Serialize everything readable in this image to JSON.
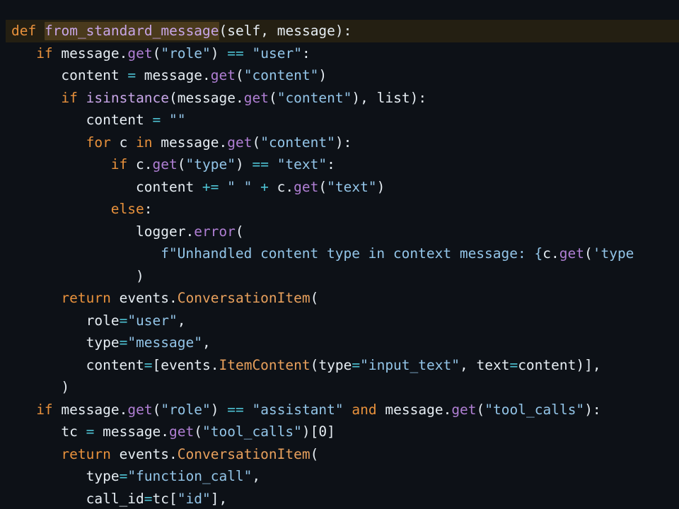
{
  "editor": {
    "language": "python",
    "background_color": "#0d1117",
    "active_line_color": "#241f12",
    "word_highlight_color": "#4a3a1c",
    "theme_colors": {
      "keyword": "#e8913c",
      "function_name": "#c8a6e8",
      "method": "#b07fd4",
      "builtin": "#c8a6e8",
      "class_name": "#e8a05c",
      "string": "#93c5e8",
      "operator": "#4ec3d4",
      "text": "#e6edf3"
    },
    "active_line_number": 1,
    "highlighted_word": "from_standard_message",
    "lines": [
      {
        "indent": 1,
        "active": true,
        "tokens": [
          {
            "t": "def",
            "c": "kw"
          },
          {
            "t": " ",
            "c": "plain"
          },
          {
            "t": "from_standard_message",
            "c": "fnname",
            "hl": true
          },
          {
            "t": "(",
            "c": "punc"
          },
          {
            "t": "self",
            "c": "plain"
          },
          {
            "t": ", ",
            "c": "punc"
          },
          {
            "t": "message",
            "c": "plain"
          },
          {
            "t": "):",
            "c": "punc"
          }
        ]
      },
      {
        "indent": 2,
        "active": false,
        "tokens": [
          {
            "t": "if",
            "c": "kw"
          },
          {
            "t": " message",
            "c": "plain"
          },
          {
            "t": ".",
            "c": "punc"
          },
          {
            "t": "get",
            "c": "method"
          },
          {
            "t": "(",
            "c": "punc"
          },
          {
            "t": "\"role\"",
            "c": "str"
          },
          {
            "t": ")",
            "c": "punc"
          },
          {
            "t": " ",
            "c": "plain"
          },
          {
            "t": "==",
            "c": "op"
          },
          {
            "t": " ",
            "c": "plain"
          },
          {
            "t": "\"user\"",
            "c": "str"
          },
          {
            "t": ":",
            "c": "punc"
          }
        ]
      },
      {
        "indent": 3,
        "active": false,
        "tokens": [
          {
            "t": "content ",
            "c": "plain"
          },
          {
            "t": "=",
            "c": "op"
          },
          {
            "t": " message",
            "c": "plain"
          },
          {
            "t": ".",
            "c": "punc"
          },
          {
            "t": "get",
            "c": "method"
          },
          {
            "t": "(",
            "c": "punc"
          },
          {
            "t": "\"content\"",
            "c": "str"
          },
          {
            "t": ")",
            "c": "punc"
          }
        ]
      },
      {
        "indent": 3,
        "active": false,
        "tokens": [
          {
            "t": "if",
            "c": "kw"
          },
          {
            "t": " ",
            "c": "plain"
          },
          {
            "t": "isinstance",
            "c": "builtin"
          },
          {
            "t": "(",
            "c": "punc"
          },
          {
            "t": "message",
            "c": "plain"
          },
          {
            "t": ".",
            "c": "punc"
          },
          {
            "t": "get",
            "c": "method"
          },
          {
            "t": "(",
            "c": "punc"
          },
          {
            "t": "\"content\"",
            "c": "str"
          },
          {
            "t": "), ",
            "c": "punc"
          },
          {
            "t": "list",
            "c": "plain"
          },
          {
            "t": "):",
            "c": "punc"
          }
        ]
      },
      {
        "indent": 4,
        "active": false,
        "tokens": [
          {
            "t": "content ",
            "c": "plain"
          },
          {
            "t": "=",
            "c": "op"
          },
          {
            "t": " ",
            "c": "plain"
          },
          {
            "t": "\"\"",
            "c": "str"
          }
        ]
      },
      {
        "indent": 4,
        "active": false,
        "tokens": [
          {
            "t": "for",
            "c": "kw"
          },
          {
            "t": " c ",
            "c": "plain"
          },
          {
            "t": "in",
            "c": "kw"
          },
          {
            "t": " message",
            "c": "plain"
          },
          {
            "t": ".",
            "c": "punc"
          },
          {
            "t": "get",
            "c": "method"
          },
          {
            "t": "(",
            "c": "punc"
          },
          {
            "t": "\"content\"",
            "c": "str"
          },
          {
            "t": "):",
            "c": "punc"
          }
        ]
      },
      {
        "indent": 5,
        "active": false,
        "tokens": [
          {
            "t": "if",
            "c": "kw"
          },
          {
            "t": " c",
            "c": "plain"
          },
          {
            "t": ".",
            "c": "punc"
          },
          {
            "t": "get",
            "c": "method"
          },
          {
            "t": "(",
            "c": "punc"
          },
          {
            "t": "\"type\"",
            "c": "str"
          },
          {
            "t": ")",
            "c": "punc"
          },
          {
            "t": " ",
            "c": "plain"
          },
          {
            "t": "==",
            "c": "op"
          },
          {
            "t": " ",
            "c": "plain"
          },
          {
            "t": "\"text\"",
            "c": "str"
          },
          {
            "t": ":",
            "c": "punc"
          }
        ]
      },
      {
        "indent": 6,
        "active": false,
        "tokens": [
          {
            "t": "content ",
            "c": "plain"
          },
          {
            "t": "+=",
            "c": "op"
          },
          {
            "t": " ",
            "c": "plain"
          },
          {
            "t": "\" \"",
            "c": "str"
          },
          {
            "t": " ",
            "c": "plain"
          },
          {
            "t": "+",
            "c": "op"
          },
          {
            "t": " c",
            "c": "plain"
          },
          {
            "t": ".",
            "c": "punc"
          },
          {
            "t": "get",
            "c": "method"
          },
          {
            "t": "(",
            "c": "punc"
          },
          {
            "t": "\"text\"",
            "c": "str"
          },
          {
            "t": ")",
            "c": "punc"
          }
        ]
      },
      {
        "indent": 5,
        "active": false,
        "tokens": [
          {
            "t": "else",
            "c": "kw"
          },
          {
            "t": ":",
            "c": "punc"
          }
        ]
      },
      {
        "indent": 6,
        "active": false,
        "tokens": [
          {
            "t": "logger",
            "c": "plain"
          },
          {
            "t": ".",
            "c": "punc"
          },
          {
            "t": "error",
            "c": "method"
          },
          {
            "t": "(",
            "c": "punc"
          }
        ]
      },
      {
        "indent": 7,
        "active": false,
        "tokens": [
          {
            "t": "f\"Unhandled content type in context message: {",
            "c": "str"
          },
          {
            "t": "c",
            "c": "plain"
          },
          {
            "t": ".",
            "c": "punc"
          },
          {
            "t": "get",
            "c": "method"
          },
          {
            "t": "(",
            "c": "punc"
          },
          {
            "t": "'type",
            "c": "str"
          }
        ]
      },
      {
        "indent": 6,
        "active": false,
        "tokens": [
          {
            "t": ")",
            "c": "punc"
          }
        ]
      },
      {
        "indent": 3,
        "active": false,
        "tokens": [
          {
            "t": "return",
            "c": "kw"
          },
          {
            "t": " events",
            "c": "plain"
          },
          {
            "t": ".",
            "c": "punc"
          },
          {
            "t": "ConversationItem",
            "c": "class"
          },
          {
            "t": "(",
            "c": "punc"
          }
        ]
      },
      {
        "indent": 4,
        "active": false,
        "tokens": [
          {
            "t": "role",
            "c": "plain"
          },
          {
            "t": "=",
            "c": "op"
          },
          {
            "t": "\"user\"",
            "c": "str"
          },
          {
            "t": ",",
            "c": "punc"
          }
        ]
      },
      {
        "indent": 4,
        "active": false,
        "tokens": [
          {
            "t": "type",
            "c": "plain"
          },
          {
            "t": "=",
            "c": "op"
          },
          {
            "t": "\"message\"",
            "c": "str"
          },
          {
            "t": ",",
            "c": "punc"
          }
        ]
      },
      {
        "indent": 4,
        "active": false,
        "tokens": [
          {
            "t": "content",
            "c": "plain"
          },
          {
            "t": "=",
            "c": "op"
          },
          {
            "t": "[",
            "c": "punc"
          },
          {
            "t": "events",
            "c": "plain"
          },
          {
            "t": ".",
            "c": "punc"
          },
          {
            "t": "ItemContent",
            "c": "class"
          },
          {
            "t": "(",
            "c": "punc"
          },
          {
            "t": "type",
            "c": "plain"
          },
          {
            "t": "=",
            "c": "op"
          },
          {
            "t": "\"input_text\"",
            "c": "str"
          },
          {
            "t": ", ",
            "c": "punc"
          },
          {
            "t": "text",
            "c": "plain"
          },
          {
            "t": "=",
            "c": "op"
          },
          {
            "t": "content",
            "c": "plain"
          },
          {
            "t": ")],",
            "c": "punc"
          }
        ]
      },
      {
        "indent": 3,
        "active": false,
        "tokens": [
          {
            "t": ")",
            "c": "punc"
          }
        ]
      },
      {
        "indent": 2,
        "active": false,
        "tokens": [
          {
            "t": "if",
            "c": "kw"
          },
          {
            "t": " message",
            "c": "plain"
          },
          {
            "t": ".",
            "c": "punc"
          },
          {
            "t": "get",
            "c": "method"
          },
          {
            "t": "(",
            "c": "punc"
          },
          {
            "t": "\"role\"",
            "c": "str"
          },
          {
            "t": ")",
            "c": "punc"
          },
          {
            "t": " ",
            "c": "plain"
          },
          {
            "t": "==",
            "c": "op"
          },
          {
            "t": " ",
            "c": "plain"
          },
          {
            "t": "\"assistant\"",
            "c": "str"
          },
          {
            "t": " ",
            "c": "plain"
          },
          {
            "t": "and",
            "c": "kw"
          },
          {
            "t": " message",
            "c": "plain"
          },
          {
            "t": ".",
            "c": "punc"
          },
          {
            "t": "get",
            "c": "method"
          },
          {
            "t": "(",
            "c": "punc"
          },
          {
            "t": "\"tool_calls\"",
            "c": "str"
          },
          {
            "t": "):",
            "c": "punc"
          }
        ]
      },
      {
        "indent": 3,
        "active": false,
        "tokens": [
          {
            "t": "tc ",
            "c": "plain"
          },
          {
            "t": "=",
            "c": "op"
          },
          {
            "t": " message",
            "c": "plain"
          },
          {
            "t": ".",
            "c": "punc"
          },
          {
            "t": "get",
            "c": "method"
          },
          {
            "t": "(",
            "c": "punc"
          },
          {
            "t": "\"tool_calls\"",
            "c": "str"
          },
          {
            "t": ")[",
            "c": "punc"
          },
          {
            "t": "0",
            "c": "num"
          },
          {
            "t": "]",
            "c": "punc"
          }
        ]
      },
      {
        "indent": 3,
        "active": false,
        "tokens": [
          {
            "t": "return",
            "c": "kw"
          },
          {
            "t": " events",
            "c": "plain"
          },
          {
            "t": ".",
            "c": "punc"
          },
          {
            "t": "ConversationItem",
            "c": "class"
          },
          {
            "t": "(",
            "c": "punc"
          }
        ]
      },
      {
        "indent": 4,
        "active": false,
        "tokens": [
          {
            "t": "type",
            "c": "plain"
          },
          {
            "t": "=",
            "c": "op"
          },
          {
            "t": "\"function_call\"",
            "c": "str"
          },
          {
            "t": ",",
            "c": "punc"
          }
        ]
      },
      {
        "indent": 4,
        "active": false,
        "tokens": [
          {
            "t": "call_id",
            "c": "plain"
          },
          {
            "t": "=",
            "c": "op"
          },
          {
            "t": "tc",
            "c": "plain"
          },
          {
            "t": "[",
            "c": "punc"
          },
          {
            "t": "\"id\"",
            "c": "str"
          },
          {
            "t": "],",
            "c": "punc"
          }
        ]
      }
    ]
  }
}
